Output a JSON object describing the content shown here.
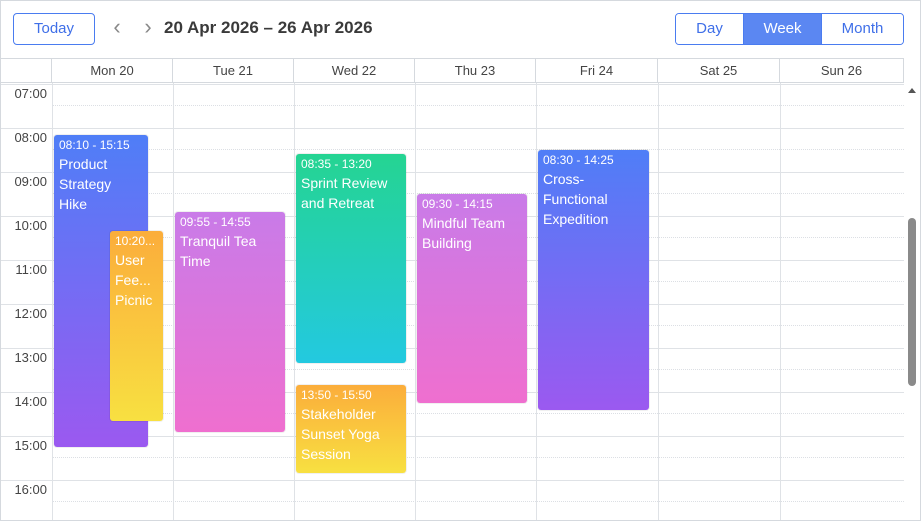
{
  "toolbar": {
    "today_label": "Today",
    "prev_glyph": "‹",
    "next_glyph": "›",
    "date_range": "20 Apr 2026 – 26 Apr 2026",
    "views": [
      {
        "label": "Day",
        "active": false
      },
      {
        "label": "Week",
        "active": true
      },
      {
        "label": "Month",
        "active": false
      }
    ]
  },
  "days": [
    "Mon 20",
    "Tue 21",
    "Wed 22",
    "Thu 23",
    "Fri 24",
    "Sat 25",
    "Sun 26"
  ],
  "time_labels": [
    "07:00",
    "08:00",
    "09:00",
    "10:00",
    "11:00",
    "12:00",
    "13:00",
    "14:00",
    "15:00",
    "16:00"
  ],
  "events": [
    {
      "day": "Mon 20",
      "time": "08:10 - 15:15",
      "title": "Product Strategy Hike",
      "color_from": "#4f7ef7",
      "color_to": "#9b59f0"
    },
    {
      "day": "Mon 20",
      "time": "10:20...",
      "title": "User Fee... Picnic",
      "color_from": "#fbad3b",
      "color_to": "#f8e041"
    },
    {
      "day": "Tue 21",
      "time": "09:55 - 14:55",
      "title": "Tranquil Tea Time",
      "color_from": "#c97be8",
      "color_to": "#ef6fcf"
    },
    {
      "day": "Wed 22",
      "time": "08:35 - 13:20",
      "title": "Sprint Review and Retreat",
      "color_from": "#25d492",
      "color_to": "#23c9e0"
    },
    {
      "day": "Wed 22",
      "time": "13:50 - 15:50",
      "title": "Stakeholder Sunset Yoga Session",
      "color_from": "#fbad3b",
      "color_to": "#f8e041"
    },
    {
      "day": "Thu 23",
      "time": "09:30 - 14:15",
      "title": "Mindful Team Building",
      "color_from": "#c97be8",
      "color_to": "#ef6fcf"
    },
    {
      "day": "Fri 24",
      "time": "08:30 - 14:25",
      "title": "Cross-Functional Expedition",
      "color_from": "#4f7ef7",
      "color_to": "#9b59f0"
    }
  ],
  "colors": {
    "accent": "#4a7cf0",
    "accent_active_bg": "#5b87f2",
    "grid_line": "#dfe2e6"
  },
  "icons": {
    "prev": "chevron-left-icon",
    "next": "chevron-right-icon",
    "scroll_up": "arrow-up-icon"
  }
}
